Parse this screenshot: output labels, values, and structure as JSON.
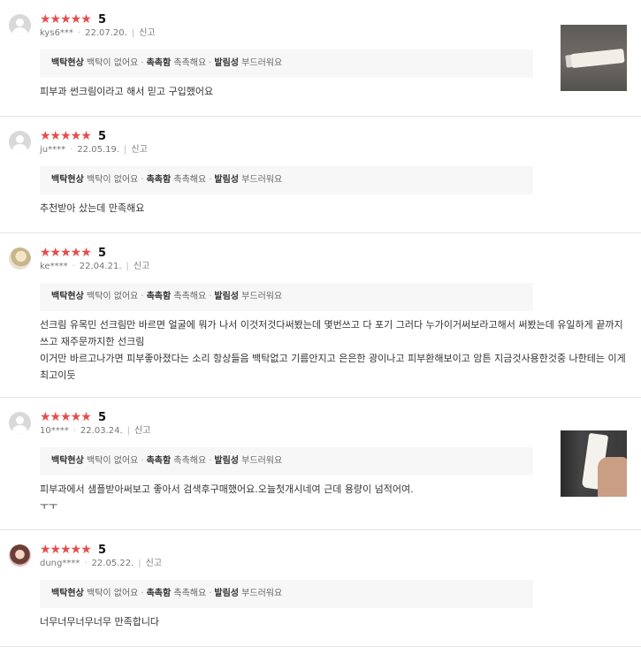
{
  "reviews": [
    {
      "stars": "★★★★★",
      "score": "5",
      "user": "kys6***",
      "date": "22.07.20.",
      "report": "신고",
      "attrs": [
        {
          "k": "백탁현상",
          "v": "백탁이 없어요"
        },
        {
          "k": "촉촉함",
          "v": "촉촉해요"
        },
        {
          "k": "발림성",
          "v": "부드러워요"
        }
      ],
      "text": "피부과 썬크림이라고 해서 믿고 구입했어요",
      "has_photo": true
    },
    {
      "stars": "★★★★★",
      "score": "5",
      "user": "ju****",
      "date": "22.05.19.",
      "report": "신고",
      "attrs": [
        {
          "k": "백탁현상",
          "v": "백탁이 없어요"
        },
        {
          "k": "촉촉함",
          "v": "촉촉해요"
        },
        {
          "k": "발림성",
          "v": "부드러워요"
        }
      ],
      "text": "추천받아 샀는데 만족해요"
    },
    {
      "stars": "★★★★★",
      "score": "5",
      "user": "ke****",
      "date": "22.04.21.",
      "report": "신고",
      "attrs": [
        {
          "k": "백탁현상",
          "v": "백탁이 없어요"
        },
        {
          "k": "촉촉함",
          "v": "촉촉해요"
        },
        {
          "k": "발림성",
          "v": "부드러워요"
        }
      ],
      "text": "선크림 유목민 선크림만 바르면 얼굴에 뭐가 나서 이것저것다써봤는데 몇번쓰고 다 포기 그러다 누가이거써보라고해서 써봤는데 유일하게 끝까지쓰고 재주문까지한 선크림\n이거만 바르고나가면 피부좋아졌다는 소리 항상들음 백탁없고 기름안지고 은은한 광이나고 피부환해보이고 암튼 지금것사용한것중 나한테는 이게 최고이듯"
    },
    {
      "stars": "★★★★★",
      "score": "5",
      "user": "10****",
      "date": "22.03.24.",
      "report": "신고",
      "attrs": [
        {
          "k": "백탁현상",
          "v": "백탁이 없어요"
        },
        {
          "k": "촉촉함",
          "v": "촉촉해요"
        },
        {
          "k": "발림성",
          "v": "부드러워요"
        }
      ],
      "text": "피부과에서 샘플받아써보고 좋아서 검색후구매했어요.오늘첫개시네여 근데 용량이 넘적어여.\nㅜㅜ",
      "has_photo": true
    },
    {
      "stars": "★★★★★",
      "score": "5",
      "user": "dung****",
      "date": "22.05.22.",
      "report": "신고",
      "attrs": [
        {
          "k": "백탁현상",
          "v": "백탁이 없어요"
        },
        {
          "k": "촉촉함",
          "v": "촉촉해요"
        },
        {
          "k": "발림성",
          "v": "부드러워요"
        }
      ],
      "text": "너무너무너무너무 만족합니다"
    }
  ]
}
